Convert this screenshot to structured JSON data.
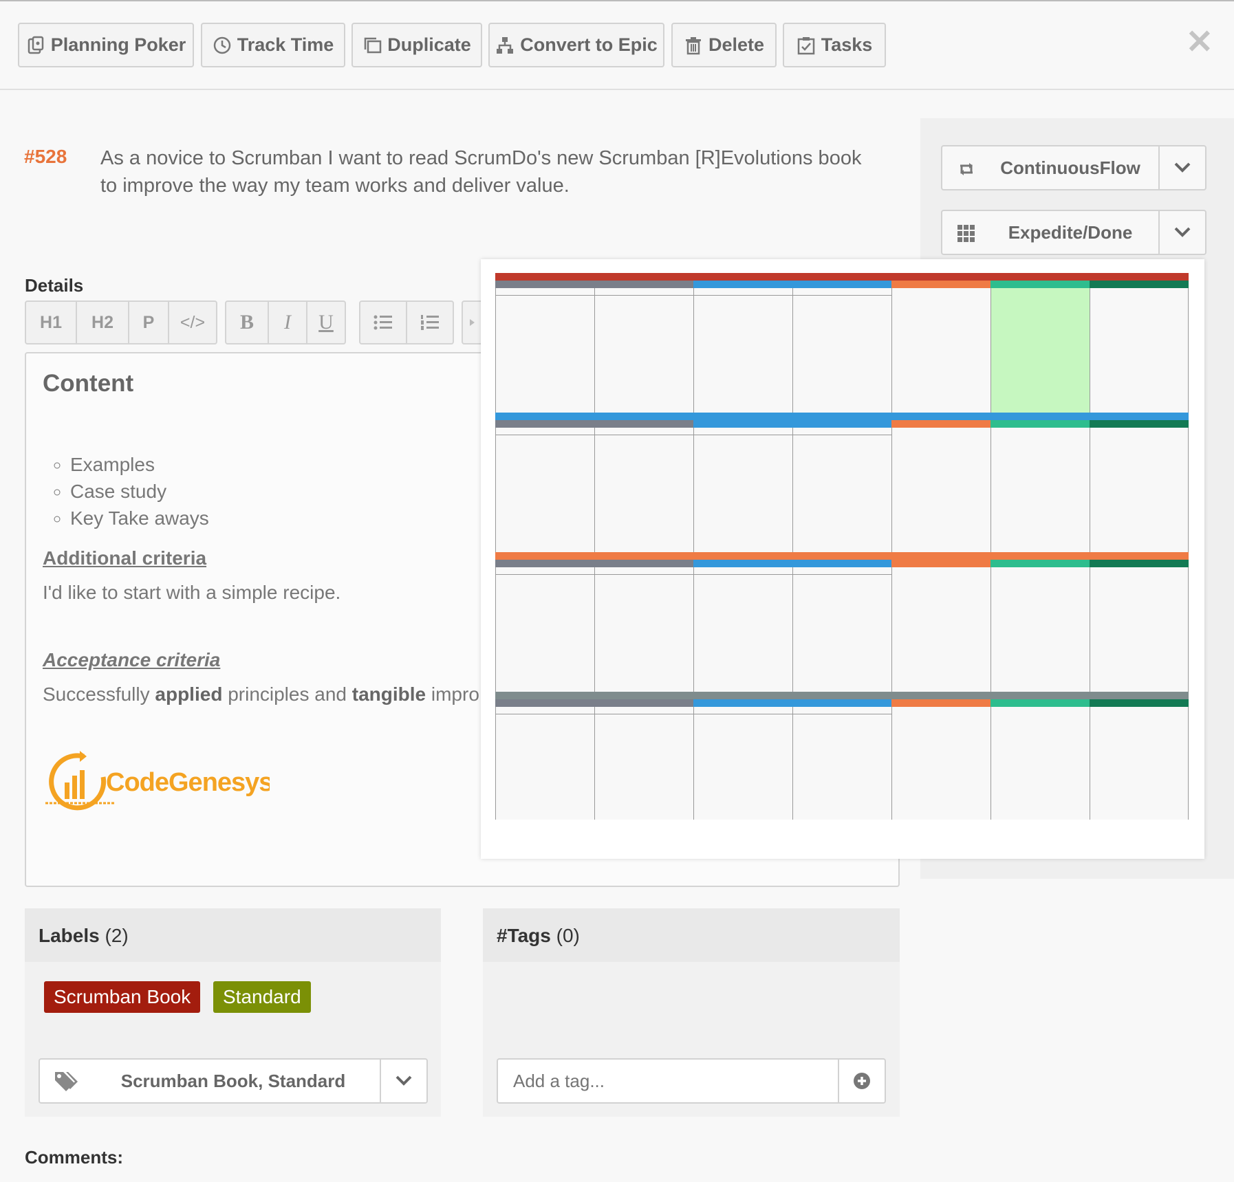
{
  "toolbar": {
    "buttons": [
      {
        "label": "Planning Poker",
        "icon": "planning-poker-icon"
      },
      {
        "label": "Track Time",
        "icon": "clock-icon"
      },
      {
        "label": "Duplicate",
        "icon": "duplicate-icon"
      },
      {
        "label": "Convert to Epic",
        "icon": "hierarchy-icon"
      },
      {
        "label": "Delete",
        "icon": "trash-icon"
      },
      {
        "label": "Tasks",
        "icon": "checkbox-icon"
      }
    ],
    "close": "✕"
  },
  "story": {
    "number": "#528",
    "title": "As a novice to Scrumban I want to read ScrumDo's new Scrumban [R]Evolutions book to improve the way my team works and deliver value."
  },
  "sidebar": {
    "workflow": {
      "label": "ContinuousFlow",
      "icon": "loop-icon"
    },
    "cell": {
      "label": "Expedite/Done",
      "icon": "grid-icon"
    }
  },
  "details": {
    "label": "Details",
    "format_buttons": {
      "group1": [
        "H1",
        "H2",
        "P",
        "</>"
      ],
      "group2": [
        "B",
        "I",
        "U"
      ],
      "group3": [
        "bullet-list-icon",
        "numbered-list-icon"
      ]
    },
    "content": {
      "heading": "Content",
      "list": [
        "Examples",
        "Case study",
        "Key Take aways"
      ],
      "additional_heading": "Additional criteria",
      "additional_text": "I'd like to start with a simple recipe.",
      "acceptance_heading": "Acceptance criteria",
      "acceptance_parts": [
        "Successfully ",
        "applied",
        " principles and ",
        "tangible",
        " impro"
      ],
      "logo_text": "CodeGenesys"
    }
  },
  "board": {
    "lanes": [
      {
        "color": "#c0392b",
        "highlight_col": 5
      },
      {
        "color": "#3498db",
        "highlight_col": -1
      },
      {
        "color": "#ef7b45",
        "highlight_col": -1
      },
      {
        "color": "#7f8c8d",
        "highlight_col": -1
      }
    ],
    "header_colors": [
      "#7a7f8a",
      "#3498db",
      "#ef7b45",
      "#2ebd8e",
      "#137a54"
    ],
    "highlight_color": "#c6f7c0"
  },
  "labels": {
    "title": "Labels",
    "count": "(2)",
    "items": [
      {
        "text": "Scrumban Book",
        "color": "#a31d0e"
      },
      {
        "text": "Standard",
        "color": "#7b9006"
      }
    ],
    "selected": "Scrumban Book, Standard"
  },
  "tags": {
    "title": "#Tags",
    "count": "(0)",
    "placeholder": "Add a tag..."
  },
  "comments": {
    "label": "Comments:"
  }
}
